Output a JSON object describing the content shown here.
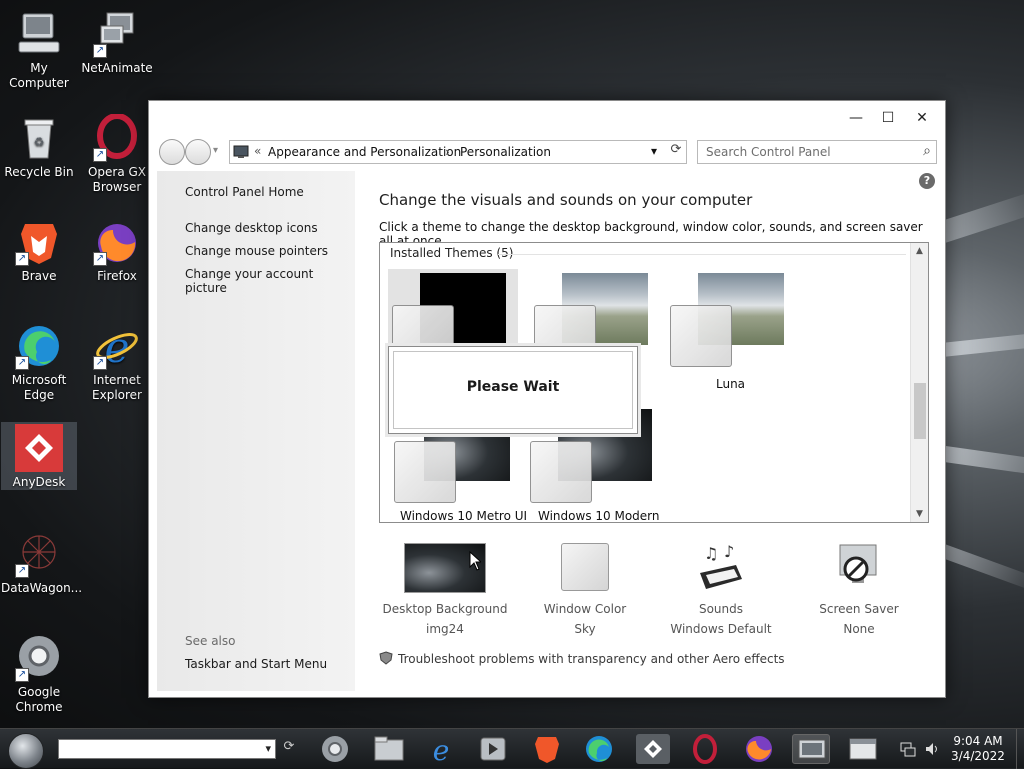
{
  "desktop": {
    "icons": [
      {
        "label": "My Computer"
      },
      {
        "label": "NetAnimate"
      },
      {
        "label": "Recycle Bin"
      },
      {
        "label": "Opera GX Browser"
      },
      {
        "label": "Brave"
      },
      {
        "label": "Firefox"
      },
      {
        "label": "Microsoft Edge"
      },
      {
        "label": "Internet Explorer"
      },
      {
        "label": "AnyDesk"
      },
      {
        "label": "DataWagon..."
      },
      {
        "label": "Google Chrome"
      }
    ]
  },
  "window": {
    "controls": {
      "minimize": "—",
      "maximize": "☐",
      "close": "✕"
    },
    "address": {
      "prefix": "«",
      "crumbs": [
        "Appearance and Personalization",
        "Personalization"
      ],
      "separator": "›",
      "dropdown": "▾",
      "refresh": "⟳"
    },
    "search": {
      "placeholder": "Search Control Panel",
      "icon": "⌕"
    },
    "sidebar": {
      "home": "Control Panel Home",
      "links": [
        "Change desktop icons",
        "Change mouse pointers",
        "Change your account picture"
      ],
      "see_also": "See also",
      "see_also_links": [
        "Taskbar and Start Menu"
      ]
    },
    "main": {
      "heading": "Change the visuals and sounds on your computer",
      "subheading": "Click a theme to change the desktop background, window color, sounds, and screen saver all at once.",
      "help": "?",
      "group_label": "Installed Themes (5)",
      "themes": [
        {
          "name": "",
          "image": "black"
        },
        {
          "name": "",
          "image": "sky"
        },
        {
          "name": "Luna",
          "image": "sky"
        },
        {
          "name": "Windows 10 Metro UI",
          "image": "winbg"
        },
        {
          "name": "Windows 10 Modern",
          "image": "winbg"
        }
      ],
      "please_wait": "Please Wait",
      "scroll_up": "▲",
      "scroll_down": "▼"
    },
    "bottom": [
      {
        "title": "Desktop Background",
        "value": "img24",
        "icon": "wallpaper-icon"
      },
      {
        "title": "Window Color",
        "value": "Sky",
        "icon": "color-swatch-icon"
      },
      {
        "title": "Sounds",
        "value": "Windows Default",
        "icon": "music-keyboard-icon"
      },
      {
        "title": "Screen Saver",
        "value": "None",
        "icon": "no-screensaver-icon"
      }
    ],
    "troubleshoot": "Troubleshoot problems with transparency and other Aero effects"
  },
  "taskbar": {
    "addr_dropdown": "▾",
    "addr_go": "⟳",
    "clock": {
      "time": "9:04 AM",
      "date": "3/4/2022"
    }
  }
}
